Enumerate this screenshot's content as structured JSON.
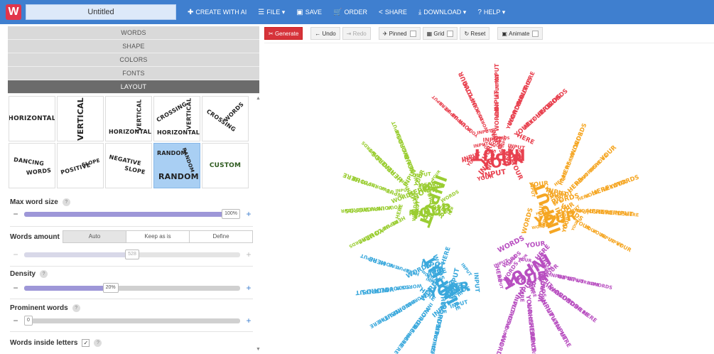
{
  "app": {
    "logo_letter": "W",
    "document_title": "Untitled"
  },
  "menu": [
    {
      "icon": "✚",
      "label": "CREATE WITH AI",
      "name": "create-with-ai"
    },
    {
      "icon": "☰",
      "label": "FILE ▾",
      "name": "file"
    },
    {
      "icon": "▣",
      "label": "SAVE",
      "name": "save"
    },
    {
      "icon": "🛒",
      "label": "ORDER",
      "name": "order"
    },
    {
      "icon": "<",
      "label": "SHARE",
      "name": "share"
    },
    {
      "icon": "⤓",
      "label": "DOWNLOAD ▾",
      "name": "download"
    },
    {
      "icon": "?",
      "label": "HELP ▾",
      "name": "help"
    }
  ],
  "accordion": [
    "WORDS",
    "SHAPE",
    "COLORS",
    "FONTS",
    "LAYOUT"
  ],
  "layouts": [
    {
      "id": "horizontal",
      "lines": [
        "HORIZONTAL"
      ]
    },
    {
      "id": "vertical",
      "lines": [
        "VERTICAL"
      ]
    },
    {
      "id": "horizontal-vertical",
      "lines": [
        "HORIZONTAL",
        "VERTICAL"
      ]
    },
    {
      "id": "crossing-vertical-horizontal",
      "lines": [
        "CROSSING",
        "VERTICAL",
        "HORIZONTAL"
      ]
    },
    {
      "id": "crossing-words",
      "lines": [
        "CROSSING",
        "WORDS"
      ]
    },
    {
      "id": "dancing-words",
      "lines": [
        "DANCING",
        "WORDS"
      ]
    },
    {
      "id": "positive-slope",
      "lines": [
        "POSITIVE",
        "SLOPE"
      ]
    },
    {
      "id": "negative-slope",
      "lines": [
        "NEGATIVE",
        "SLOPE"
      ]
    },
    {
      "id": "random",
      "lines": [
        "RANDOM",
        "RANDOM",
        "RANDOM"
      ],
      "selected": true
    },
    {
      "id": "custom",
      "lines": [
        "CUSTOM"
      ]
    }
  ],
  "controls": {
    "max_word_size": {
      "label": "Max word size",
      "value_text": "100%",
      "fraction": 1.0
    },
    "words_amount": {
      "label": "Words amount",
      "options": [
        "Auto",
        "Keep as is",
        "Define"
      ],
      "selected": "Auto",
      "value_text": "528",
      "fraction": 0.5
    },
    "density": {
      "label": "Density",
      "value_text": "20%",
      "fraction": 0.4
    },
    "prominent_words": {
      "label": "Prominent words",
      "value_text": "0",
      "fraction": 0.0
    },
    "words_inside_letters": {
      "label": "Words inside letters",
      "checked": "✓"
    },
    "help_glyph": "?"
  },
  "toolbar": {
    "generate": "Generate",
    "undo": "Undo",
    "redo": "Redo",
    "pinned": "Pinned",
    "grid": "Grid",
    "reset": "Reset",
    "animate": "Animate"
  },
  "cloud": {
    "colors": {
      "red": "#e8414f",
      "green": "#9acd32",
      "orange": "#f5a623",
      "blue": "#3aa8dc",
      "purple": "#b84fc0"
    },
    "words": [
      "INPUT",
      "YOUR",
      "WORDS",
      "HERE"
    ]
  }
}
